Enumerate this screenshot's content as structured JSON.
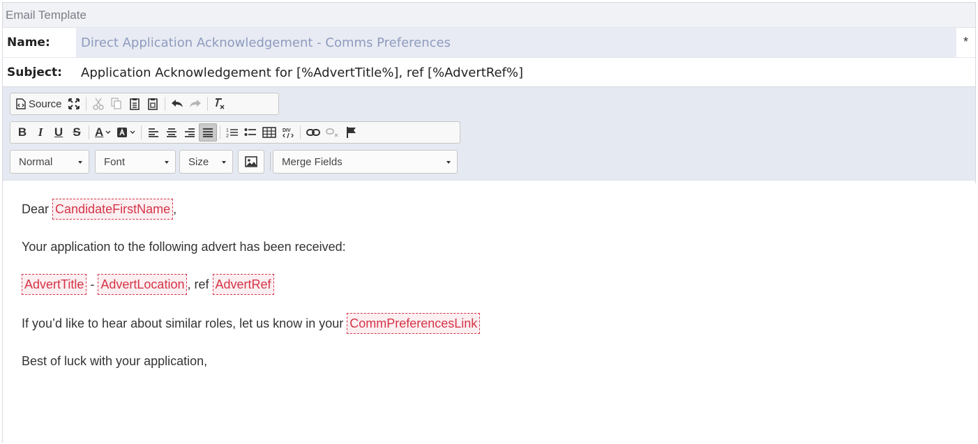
{
  "panel": {
    "title": "Email Template"
  },
  "name_row": {
    "label": "Name:",
    "value": "Direct Application Acknowledgement - Comms Preferences",
    "required_mark": "*"
  },
  "subject_row": {
    "label": "Subject:",
    "value": "Application Acknowledgement for [%AdvertTitle%], ref [%AdvertRef%]"
  },
  "toolbar": {
    "source_label": "Source",
    "bold": "B",
    "italic": "I",
    "underline": "U",
    "strike": "S",
    "text_color": "A",
    "format_combo": "Normal",
    "font_combo": "Font",
    "size_combo": "Size",
    "merge_fields_combo": "Merge Fields"
  },
  "editor": {
    "greeting_prefix": "Dear",
    "greeting_field": "CandidateFirstName",
    "greeting_suffix": ",",
    "line2": "Your application to the following advert has been received:",
    "advert_title_field": "AdvertTitle",
    "dash": "-",
    "advert_location_field": "AdvertLocation",
    "ref_text": ", ref",
    "advert_ref_field": "AdvertRef",
    "line4_prefix": "If you’d like to hear about similar roles, let us know in your",
    "comm_pref_field": "CommPreferencesLink",
    "line5": "Best of luck with your application,"
  },
  "colors": {
    "merge_field": "#d63447",
    "toolbar_bg": "#e5e9f2",
    "name_field_bg": "#e8ebf3"
  }
}
